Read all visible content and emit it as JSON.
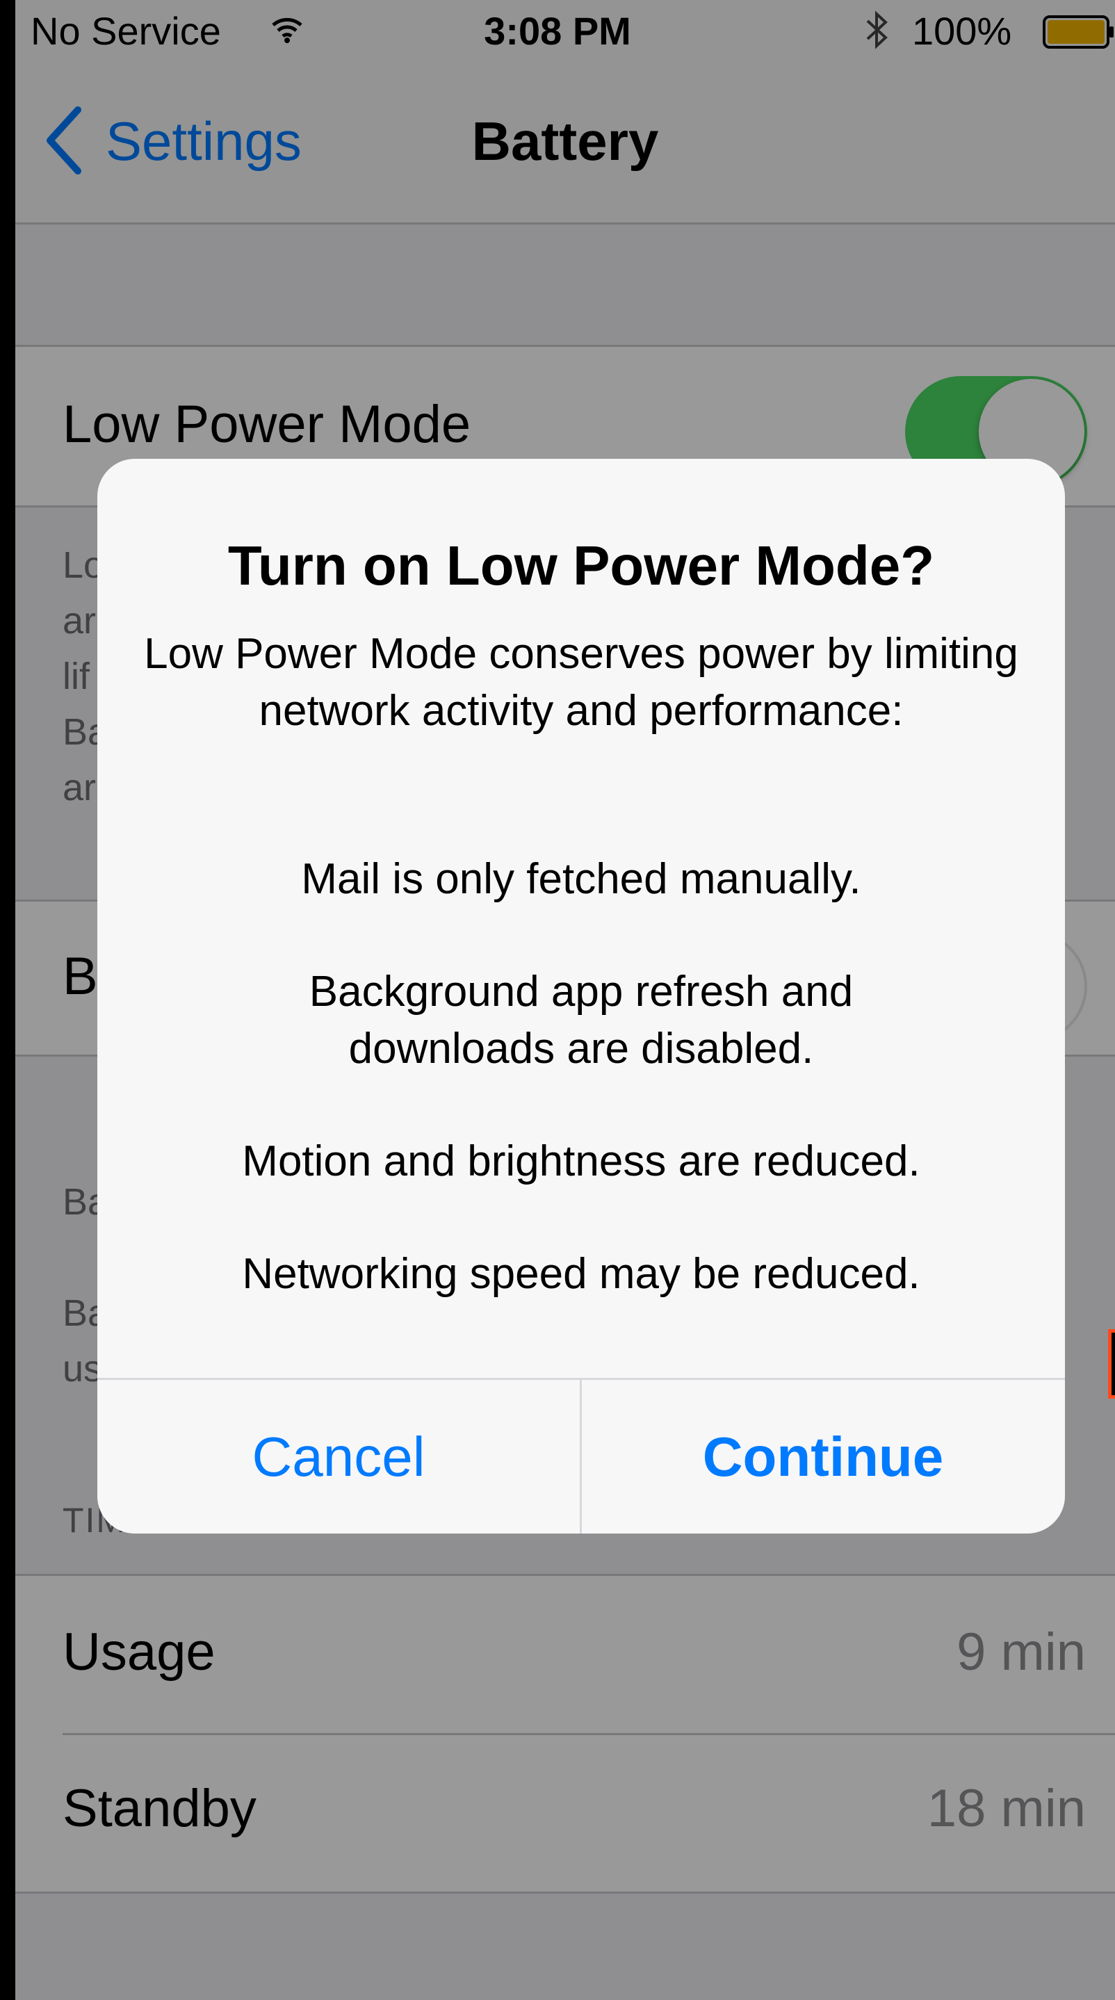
{
  "status_bar": {
    "carrier": "No Service",
    "time": "3:08 PM",
    "battery_percent": "100%",
    "wifi_icon": "wifi-icon",
    "bluetooth_icon": "bluetooth-icon",
    "battery_icon": "battery-icon",
    "battery_level": 1.0,
    "battery_color": "#f0b400"
  },
  "nav": {
    "back_label": "Settings",
    "title": "Battery"
  },
  "settings": {
    "low_power_mode_label": "Low Power Mode",
    "low_power_mode_on": true,
    "footer_partial": [
      "Lo",
      "ar",
      "lif",
      "Ba",
      "ar"
    ],
    "battery_percentage_partial": "B",
    "battery_percentage_on": false,
    "usage_header_partial": [
      "Ba",
      "Ba",
      "us"
    ],
    "time_since_header": "TIME SINCE LAST FULL CHARGE",
    "usage_label": "Usage",
    "usage_value": "9 min",
    "standby_label": "Standby",
    "standby_value": "18 min"
  },
  "alert": {
    "title": "Turn on Low Power Mode?",
    "intro": "Low Power Mode conserves power by limiting network activity and performance:",
    "bullet_1": "Mail is only fetched manually.",
    "bullet_2": "Background app refresh and downloads are disabled.",
    "bullet_3": "Motion and brightness are reduced.",
    "bullet_4": "Networking speed may be reduced.",
    "cancel_label": "Cancel",
    "continue_label": "Continue"
  },
  "colors": {
    "accent": "#007aff",
    "toggle_on": "#4cd964"
  }
}
